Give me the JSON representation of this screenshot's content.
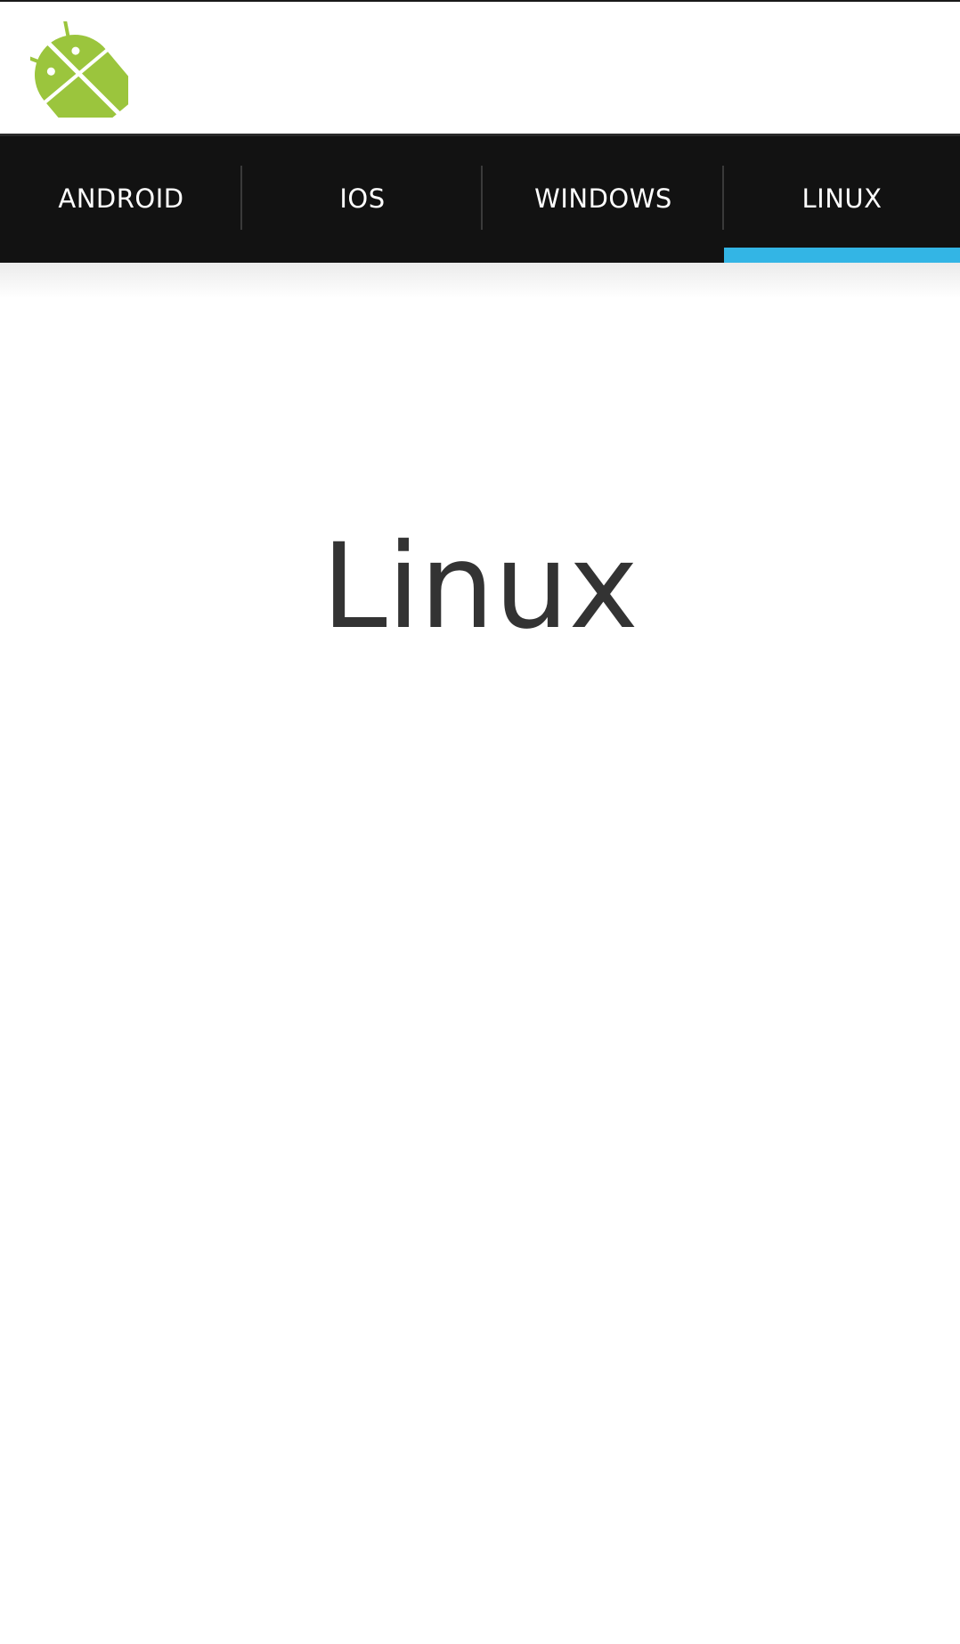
{
  "app": {
    "icon": "android-robot-icon",
    "icon_color": "#9bc53d"
  },
  "tabs": [
    {
      "label": "ANDROID",
      "selected": false
    },
    {
      "label": "IOS",
      "selected": false
    },
    {
      "label": "WINDOWS",
      "selected": false
    },
    {
      "label": "LINUX",
      "selected": true
    }
  ],
  "colors": {
    "tab_bar_bg": "#121212",
    "tab_indicator": "#33b5e5",
    "content_text": "#333333"
  },
  "content": {
    "title": "Linux"
  }
}
